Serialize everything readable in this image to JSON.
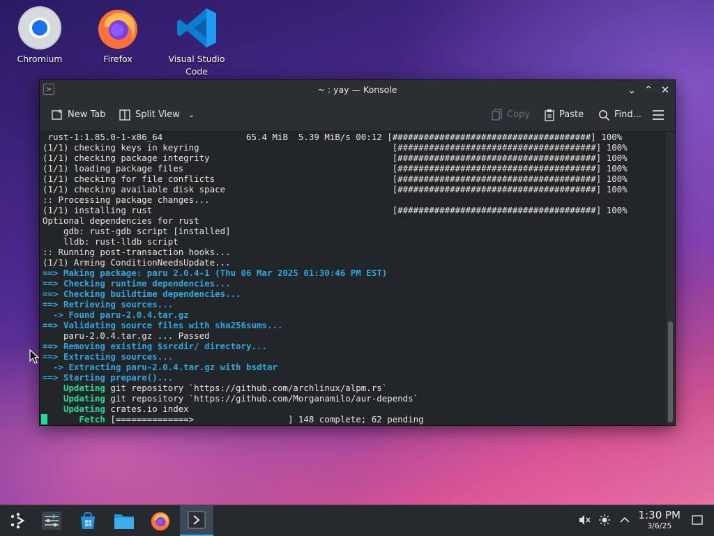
{
  "desktop": {
    "icons": [
      {
        "label": "Chromium"
      },
      {
        "label": "Firefox"
      },
      {
        "label": "Visual Studio Code"
      }
    ]
  },
  "window": {
    "title": "~ : yay — Konsole",
    "toolbar": {
      "new_tab": "New Tab",
      "split_view": "Split View",
      "copy": "Copy",
      "paste": "Paste",
      "find": "Find..."
    }
  },
  "terminal": {
    "lines": [
      {
        "text": " rust-1:1.85.0-1-x86_64                65.4 MiB  5.39 MiB/s 00:12 [######################################] 100%",
        "style": "plain"
      },
      {
        "text": "(1/1) checking keys in keyring                                     [######################################] 100%",
        "style": "plain"
      },
      {
        "text": "(1/1) checking package integrity                                   [######################################] 100%",
        "style": "plain"
      },
      {
        "text": "(1/1) loading package files                                        [######################################] 100%",
        "style": "plain"
      },
      {
        "text": "(1/1) checking for file conflicts                                  [######################################] 100%",
        "style": "plain"
      },
      {
        "text": "(1/1) checking available disk space                                [######################################] 100%",
        "style": "plain"
      },
      {
        "text": ":: Processing package changes...",
        "style": "plain"
      },
      {
        "text": "(1/1) installing rust                                              [######################################] 100%",
        "style": "plain"
      },
      {
        "text": "Optional dependencies for rust",
        "style": "plain"
      },
      {
        "text": "    gdb: rust-gdb script [installed]",
        "style": "plain"
      },
      {
        "text": "    lldb: rust-lldb script",
        "style": "plain"
      },
      {
        "text": ":: Running post-transaction hooks...",
        "style": "plain"
      },
      {
        "text": "(1/1) Arming ConditionNeedsUpdate...",
        "style": "plain"
      },
      {
        "text": "==> Making package: paru 2.0.4-1 (Thu 06 Mar 2025 01:30:46 PM EST)",
        "style": "blue"
      },
      {
        "text": "==> Checking runtime dependencies...",
        "style": "blue"
      },
      {
        "text": "==> Checking buildtime dependencies...",
        "style": "blue"
      },
      {
        "text": "==> Retrieving sources...",
        "style": "blue"
      },
      {
        "text": "  -> Found paru-2.0.4.tar.gz",
        "style": "blue"
      },
      {
        "text": "==> Validating source files with sha256sums...",
        "style": "blue"
      },
      {
        "text": "    paru-2.0.4.tar.gz ... Passed",
        "style": "plain"
      },
      {
        "text": "==> Removing existing $srcdir/ directory...",
        "style": "blue"
      },
      {
        "text": "==> Extracting sources...",
        "style": "blue"
      },
      {
        "text": "  -> Extracting paru-2.0.4.tar.gz with bsdtar",
        "style": "blue"
      },
      {
        "text": "==> Starting prepare()...",
        "style": "blue"
      },
      {
        "prefix": "    Updating",
        "text": " git repository `https://github.com/archlinux/alpm.rs`",
        "style": "green-prefix"
      },
      {
        "prefix": "    Updating",
        "text": " git repository `https://github.com/Morganamilo/aur-depends`",
        "style": "green-prefix"
      },
      {
        "prefix": "    Updating",
        "text": " crates.io index",
        "style": "green-prefix"
      },
      {
        "prefix": "       Fetch",
        "text": " [==============>                  ] 148 complete; 62 pending",
        "style": "green-prefix"
      }
    ]
  },
  "taskbar": {
    "clock_time": "1:30 PM",
    "clock_date": "3/6/25"
  },
  "colors": {
    "accent": "#3daee9",
    "terminal_bg": "#232629",
    "blue_text": "#2ea8e0",
    "green_text": "#1cdc9a"
  }
}
